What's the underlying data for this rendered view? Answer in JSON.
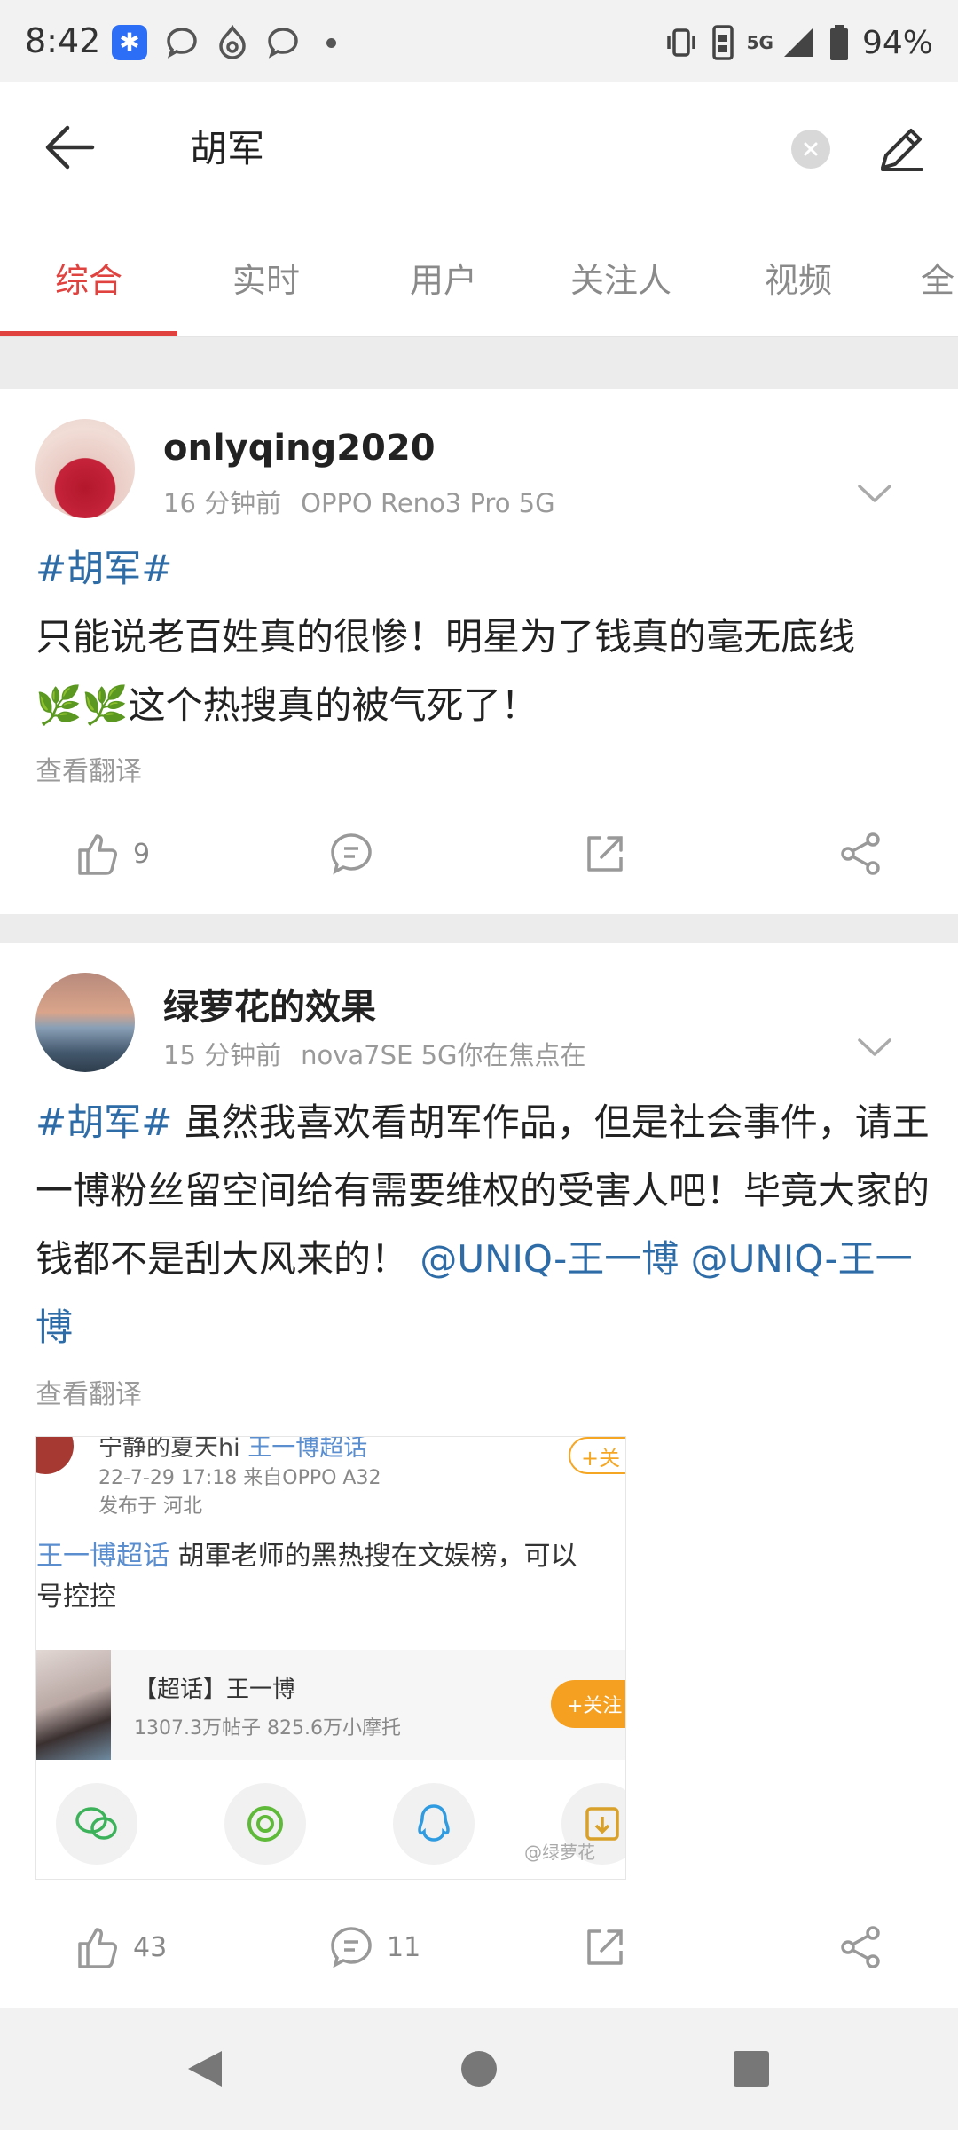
{
  "status_bar": {
    "time": "8:42",
    "network": "5G",
    "battery": "94%",
    "notification_icons": [
      "app-badge-icon",
      "chat-icon",
      "flame-icon",
      "chat-icon",
      "dot-icon"
    ],
    "right_icons": [
      "vibrate-icon",
      "sim-icon",
      "signal-icon",
      "battery-icon"
    ]
  },
  "search": {
    "query": "胡军"
  },
  "tabs": [
    {
      "label": "综合",
      "active": true
    },
    {
      "label": "实时",
      "active": false
    },
    {
      "label": "用户",
      "active": false
    },
    {
      "label": "关注人",
      "active": false
    },
    {
      "label": "视频",
      "active": false
    },
    {
      "label": "全",
      "active": false
    }
  ],
  "posts": [
    {
      "username": "onlyqing2020",
      "time": "16 分钟前",
      "device": "OPPO Reno3 Pro 5G",
      "topic": "#胡军#",
      "text_line1": "只能说老百姓真的很惨！明星为了钱真的毫无底线",
      "text_line2": "这个热搜真的被气死了！",
      "emoji": "🌿🌿",
      "translate": "查看翻译",
      "like_count": "9",
      "comment_count": "",
      "accent": "#2e6ca8"
    },
    {
      "username": "绿萝花的效果",
      "time": "15 分钟前",
      "device": "nova7SE 5G你在焦点在",
      "topic": "#胡军#",
      "text_part1": " 虽然我喜欢看胡军作品，但是社会事件，请王一博粉丝留空间给有需要维权的受害人吧！毕竟大家的钱都不是刮大风来的！",
      "mention1": "@UNIQ-王一博",
      "mention2": "@UNIQ-王一博",
      "translate": "查看翻译",
      "like_count": "43",
      "comment_count": "11",
      "embed": {
        "name": "宁静的夏天hi",
        "supertopic": "王一博超话",
        "follow": "+关",
        "meta1": "22-7-29 17:18  来自OPPO A32",
        "meta2": "发布于 河北",
        "text_topic": "王一博超话",
        "text": " 胡軍老师的黑热搜在文娱榜，可以",
        "text2": "号控控",
        "card_title": "【超话】王一博",
        "card_sub": "1307.3万帖子 825.6万小摩托",
        "card_follow": "+关注",
        "watermark": "@绿萝花"
      }
    }
  ],
  "colors": {
    "accent_red": "#e0433f",
    "link_blue": "#2e6ca8",
    "muted": "#9a9a9a"
  }
}
